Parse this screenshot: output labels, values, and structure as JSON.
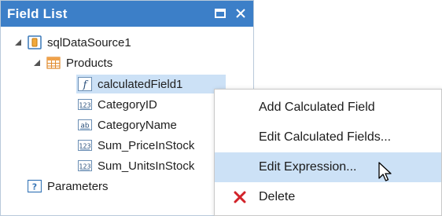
{
  "panel": {
    "title": "Field List",
    "buttons": [
      {
        "name": "maximize-icon",
        "label": "maximize"
      },
      {
        "name": "close-icon",
        "label": "close"
      }
    ]
  },
  "tree": {
    "datasource": "sqlDataSource1",
    "table": "Products",
    "fields": [
      {
        "label": "calculatedField1",
        "icon": "function-icon",
        "selected": true
      },
      {
        "label": "CategoryID",
        "icon": "number-field-icon"
      },
      {
        "label": "CategoryName",
        "icon": "text-field-icon"
      },
      {
        "label": "Sum_PriceInStock",
        "icon": "number-field-icon"
      },
      {
        "label": "Sum_UnitsInStock",
        "icon": "number-field-icon"
      }
    ],
    "parameters": "Parameters"
  },
  "context_menu": {
    "items": [
      {
        "label": "Add Calculated Field"
      },
      {
        "label": "Edit Calculated Fields..."
      },
      {
        "label": "Edit Expression...",
        "hovered": true
      },
      {
        "label": "Delete",
        "icon": "delete-x-icon"
      }
    ]
  },
  "colors": {
    "titlebar": "#3c7fc8",
    "selection": "#cce1f6",
    "delete_icon": "#d2232a"
  }
}
